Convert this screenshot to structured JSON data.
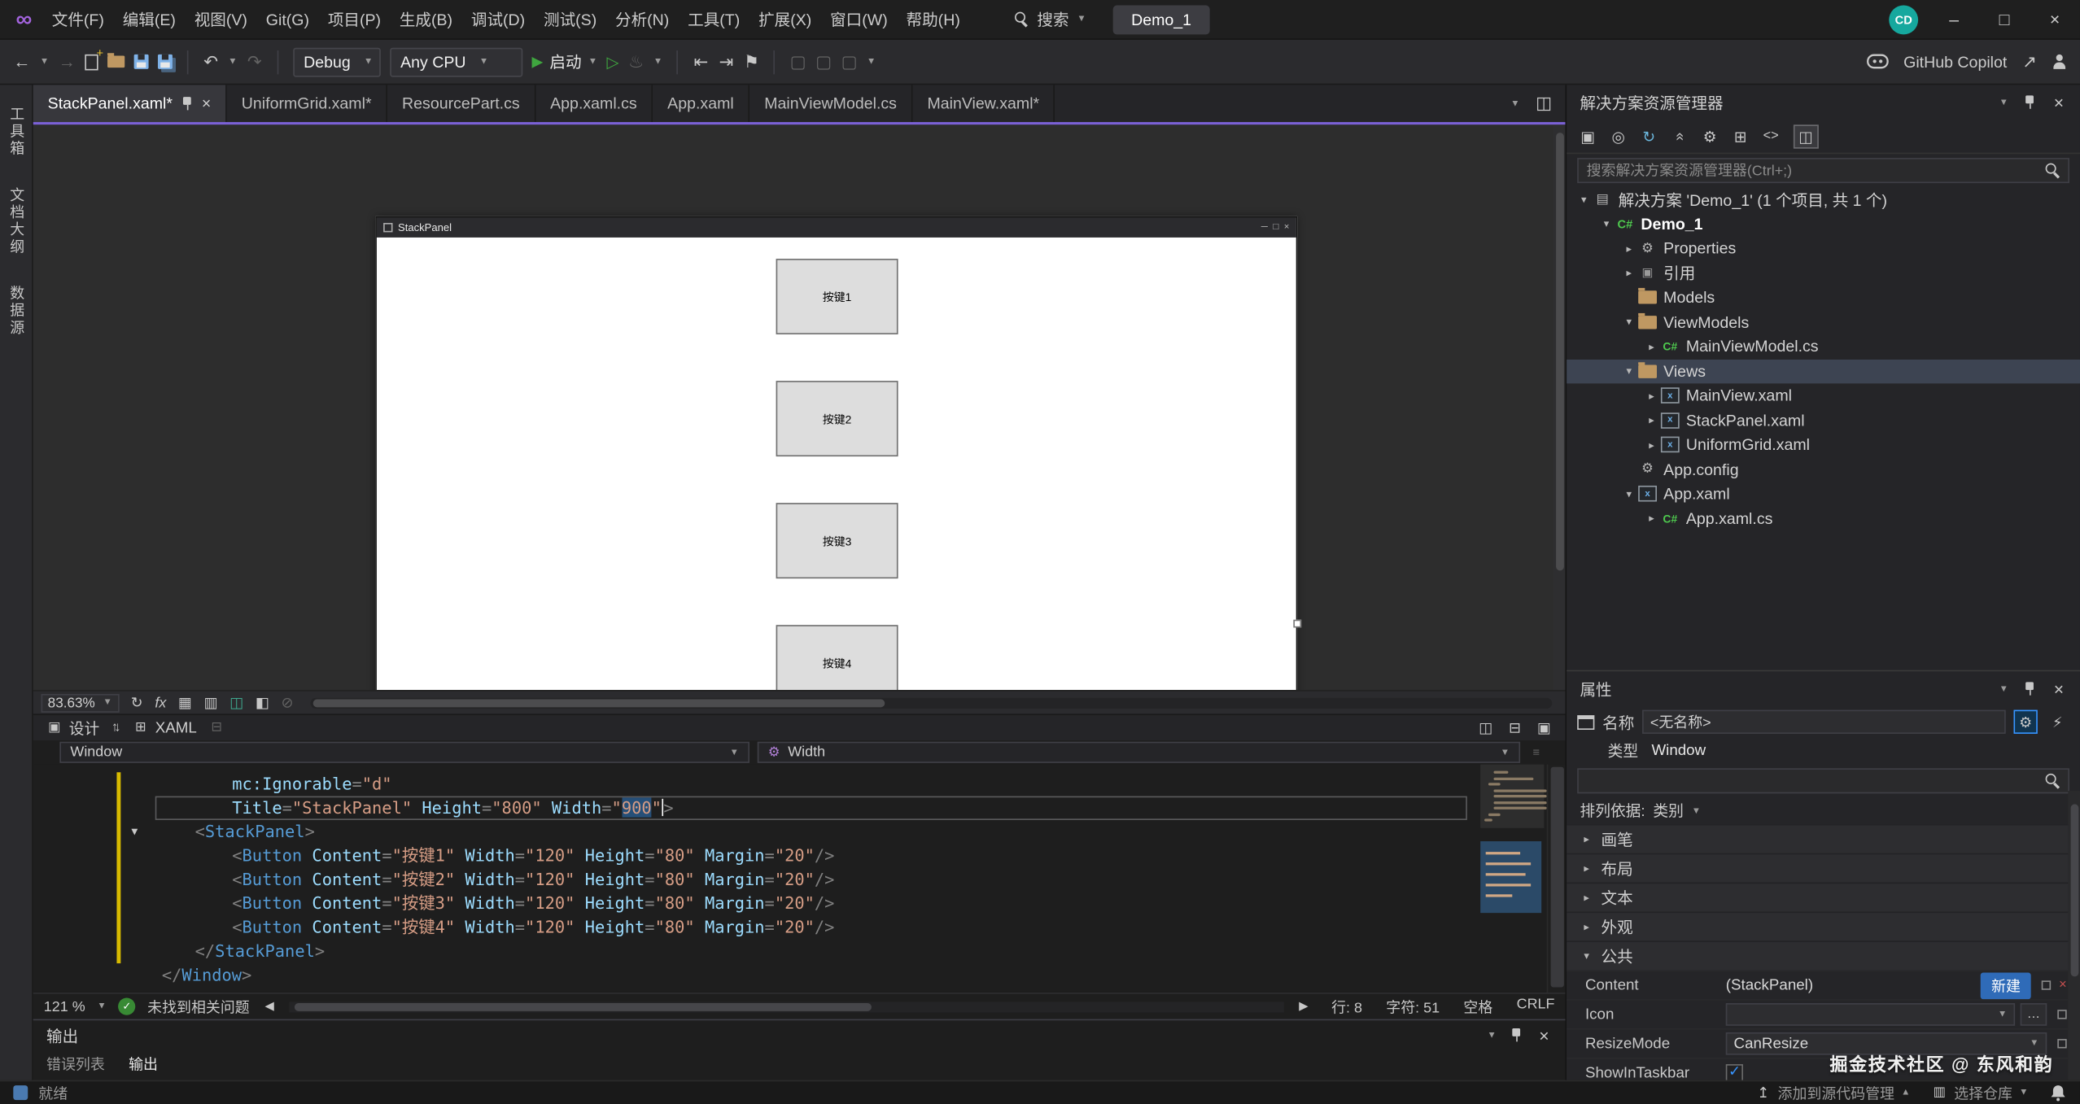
{
  "colors": {
    "accent_purple": "#7b61d6",
    "selection_blue": "#264f78",
    "run_green": "#3fa63f",
    "modified_yellow": "#d7ba00",
    "folder_gold": "#bf9862",
    "csharp_green": "#4ec94e",
    "avatar_teal": "#16a89e",
    "check_blue": "#3794ff",
    "new_button_blue": "#2f6bb8",
    "close_red": "#c75050",
    "logo_purple": "#a263dc",
    "status_ok_green": "#388a34"
  },
  "titlebar": {
    "menus": [
      "文件(F)",
      "编辑(E)",
      "视图(V)",
      "Git(G)",
      "项目(P)",
      "生成(B)",
      "调试(D)",
      "测试(S)",
      "分析(N)",
      "工具(T)",
      "扩展(X)",
      "窗口(W)",
      "帮助(H)"
    ],
    "search_label": "搜索",
    "solution_name": "Demo_1",
    "account_initials": "CD"
  },
  "toolbar": {
    "debug_target": "Debug",
    "platform": "Any CPU",
    "start_label": "启动",
    "copilot_label": "GitHub Copilot"
  },
  "left_strip": [
    "工具箱",
    "文档大纲",
    "数据源"
  ],
  "doc_tabs": {
    "active_index": 0,
    "items": [
      "StackPanel.xaml*",
      "UniformGrid.xaml*",
      "ResourcePart.cs",
      "App.xaml.cs",
      "App.xaml",
      "MainViewModel.cs",
      "MainView.xaml*"
    ]
  },
  "designer": {
    "window_title": "StackPanel",
    "buttons": [
      "按键1",
      "按键2",
      "按键3",
      "按键4"
    ],
    "zoom": "83.63%"
  },
  "split_tabs": {
    "design": "设计",
    "xaml": "XAML"
  },
  "breadcrumb": {
    "element": "Window",
    "member": "Width"
  },
  "code": {
    "lines": [
      {
        "indent": 53,
        "tokens": [
          {
            "t": "mc:Ignorable",
            "c": "attr"
          },
          {
            "t": "=",
            "c": "delim"
          },
          {
            "t": "\"d\"",
            "c": "str"
          }
        ]
      },
      {
        "indent": 53,
        "current": true,
        "tokens": [
          {
            "t": "Title",
            "c": "attr"
          },
          {
            "t": "=",
            "c": "delim"
          },
          {
            "t": "\"StackPanel\"",
            "c": "str"
          },
          {
            "t": " ",
            "c": "sp"
          },
          {
            "t": "Height",
            "c": "attr"
          },
          {
            "t": "=",
            "c": "delim"
          },
          {
            "t": "\"800\"",
            "c": "str"
          },
          {
            "t": " ",
            "c": "sp"
          },
          {
            "t": "Width",
            "c": "attr"
          },
          {
            "t": "=",
            "c": "delim"
          },
          {
            "t": "\"",
            "c": "str"
          },
          {
            "t": "900",
            "c": "str",
            "sel": true
          },
          {
            "t": "\"",
            "c": "str",
            "caret": true
          },
          {
            "t": ">",
            "c": "delim"
          }
        ]
      },
      {
        "indent": 25,
        "fold": "open",
        "tokens": [
          {
            "t": "<",
            "c": "delim"
          },
          {
            "t": "StackPanel",
            "c": "tag"
          },
          {
            "t": ">",
            "c": "delim"
          }
        ]
      },
      {
        "indent": 53,
        "tokens": [
          {
            "t": "<",
            "c": "delim"
          },
          {
            "t": "Button",
            "c": "tag"
          },
          {
            "t": " ",
            "c": "sp"
          },
          {
            "t": "Content",
            "c": "attr"
          },
          {
            "t": "=",
            "c": "delim"
          },
          {
            "t": "\"按键1\"",
            "c": "str"
          },
          {
            "t": " ",
            "c": "sp"
          },
          {
            "t": "Width",
            "c": "attr"
          },
          {
            "t": "=",
            "c": "delim"
          },
          {
            "t": "\"120\"",
            "c": "str"
          },
          {
            "t": " ",
            "c": "sp"
          },
          {
            "t": "Height",
            "c": "attr"
          },
          {
            "t": "=",
            "c": "delim"
          },
          {
            "t": "\"80\"",
            "c": "str"
          },
          {
            "t": " ",
            "c": "sp"
          },
          {
            "t": "Margin",
            "c": "attr"
          },
          {
            "t": "=",
            "c": "delim"
          },
          {
            "t": "\"20\"",
            "c": "str"
          },
          {
            "t": "/>",
            "c": "delim"
          }
        ]
      },
      {
        "indent": 53,
        "tokens": [
          {
            "t": "<",
            "c": "delim"
          },
          {
            "t": "Button",
            "c": "tag"
          },
          {
            "t": " ",
            "c": "sp"
          },
          {
            "t": "Content",
            "c": "attr"
          },
          {
            "t": "=",
            "c": "delim"
          },
          {
            "t": "\"按键2\"",
            "c": "str"
          },
          {
            "t": " ",
            "c": "sp"
          },
          {
            "t": "Width",
            "c": "attr"
          },
          {
            "t": "=",
            "c": "delim"
          },
          {
            "t": "\"120\"",
            "c": "str"
          },
          {
            "t": " ",
            "c": "sp"
          },
          {
            "t": "Height",
            "c": "attr"
          },
          {
            "t": "=",
            "c": "delim"
          },
          {
            "t": "\"80\"",
            "c": "str"
          },
          {
            "t": " ",
            "c": "sp"
          },
          {
            "t": "Margin",
            "c": "attr"
          },
          {
            "t": "=",
            "c": "delim"
          },
          {
            "t": "\"20\"",
            "c": "str"
          },
          {
            "t": "/>",
            "c": "delim"
          }
        ]
      },
      {
        "indent": 53,
        "tokens": [
          {
            "t": "<",
            "c": "delim"
          },
          {
            "t": "Button",
            "c": "tag"
          },
          {
            "t": " ",
            "c": "sp"
          },
          {
            "t": "Content",
            "c": "attr"
          },
          {
            "t": "=",
            "c": "delim"
          },
          {
            "t": "\"按键3\"",
            "c": "str"
          },
          {
            "t": " ",
            "c": "sp"
          },
          {
            "t": "Width",
            "c": "attr"
          },
          {
            "t": "=",
            "c": "delim"
          },
          {
            "t": "\"120\"",
            "c": "str"
          },
          {
            "t": " ",
            "c": "sp"
          },
          {
            "t": "Height",
            "c": "attr"
          },
          {
            "t": "=",
            "c": "delim"
          },
          {
            "t": "\"80\"",
            "c": "str"
          },
          {
            "t": " ",
            "c": "sp"
          },
          {
            "t": "Margin",
            "c": "attr"
          },
          {
            "t": "=",
            "c": "delim"
          },
          {
            "t": "\"20\"",
            "c": "str"
          },
          {
            "t": "/>",
            "c": "delim"
          }
        ]
      },
      {
        "indent": 53,
        "tokens": [
          {
            "t": "<",
            "c": "delim"
          },
          {
            "t": "Button",
            "c": "tag"
          },
          {
            "t": " ",
            "c": "sp"
          },
          {
            "t": "Content",
            "c": "attr"
          },
          {
            "t": "=",
            "c": "delim"
          },
          {
            "t": "\"按键4\"",
            "c": "str"
          },
          {
            "t": " ",
            "c": "sp"
          },
          {
            "t": "Width",
            "c": "attr"
          },
          {
            "t": "=",
            "c": "delim"
          },
          {
            "t": "\"120\"",
            "c": "str"
          },
          {
            "t": " ",
            "c": "sp"
          },
          {
            "t": "Height",
            "c": "attr"
          },
          {
            "t": "=",
            "c": "delim"
          },
          {
            "t": "\"80\"",
            "c": "str"
          },
          {
            "t": " ",
            "c": "sp"
          },
          {
            "t": "Margin",
            "c": "attr"
          },
          {
            "t": "=",
            "c": "delim"
          },
          {
            "t": "\"20\"",
            "c": "str"
          },
          {
            "t": "/>",
            "c": "delim"
          }
        ]
      },
      {
        "indent": 25,
        "tokens": [
          {
            "t": "</",
            "c": "delim"
          },
          {
            "t": "StackPanel",
            "c": "tag"
          },
          {
            "t": ">",
            "c": "delim"
          }
        ]
      },
      {
        "indent": 0,
        "tokens": [
          {
            "t": "</",
            "c": "delim"
          },
          {
            "t": "Window",
            "c": "tag"
          },
          {
            "t": ">",
            "c": "delim"
          }
        ]
      }
    ]
  },
  "editor_status": {
    "zoom": "121 %",
    "message": "未找到相关问题",
    "line": "行: 8",
    "column": "字符: 51",
    "whitespace": "空格",
    "line_ending": "CRLF"
  },
  "output_panel": {
    "title": "输出",
    "tabs": [
      "错误列表",
      "输出"
    ]
  },
  "statusbar": {
    "ready": "就绪",
    "scm_label": "添加到源代码管理",
    "repo_label": "选择仓库"
  },
  "solution_explorer": {
    "title": "解决方案资源管理器",
    "search_placeholder": "搜索解决方案资源管理器(Ctrl+;)",
    "tree": [
      {
        "label": "解决方案 'Demo_1' (1 个项目, 共 1 个)",
        "icon": "solution",
        "depth": 0,
        "chev": "open"
      },
      {
        "label": "Demo_1",
        "icon": "project",
        "depth": 1,
        "chev": "open",
        "bold": true
      },
      {
        "label": "Properties",
        "icon": "properties",
        "depth": 2,
        "chev": "closed"
      },
      {
        "label": "引用",
        "icon": "references",
        "depth": 2,
        "chev": "closed"
      },
      {
        "label": "Models",
        "icon": "folder",
        "depth": 2,
        "chev": "none"
      },
      {
        "label": "ViewModels",
        "icon": "folder",
        "depth": 2,
        "chev": "open"
      },
      {
        "label": "MainViewModel.cs",
        "icon": "csharp",
        "depth": 3,
        "chev": "closed"
      },
      {
        "label": "Views",
        "icon": "folder",
        "depth": 2,
        "chev": "open",
        "selected": true
      },
      {
        "label": "MainView.xaml",
        "icon": "xaml",
        "depth": 3,
        "chev": "closed"
      },
      {
        "label": "StackPanel.xaml",
        "icon": "xaml",
        "depth": 3,
        "chev": "closed"
      },
      {
        "label": "UniformGrid.xaml",
        "icon": "xaml",
        "depth": 3,
        "chev": "closed"
      },
      {
        "label": "App.config",
        "icon": "config",
        "depth": 2,
        "chev": "none"
      },
      {
        "label": "App.xaml",
        "icon": "xaml",
        "depth": 2,
        "chev": "open"
      },
      {
        "label": "App.xaml.cs",
        "icon": "csharp",
        "depth": 3,
        "chev": "closed"
      }
    ]
  },
  "properties_panel": {
    "title": "属性",
    "name_label": "名称",
    "name_value": "<无名称>",
    "type_label": "类型",
    "type_value": "Window",
    "arrange_label": "排列依据:",
    "arrange_mode": "类别",
    "categories": [
      {
        "label": "画笔",
        "expanded": false
      },
      {
        "label": "布局",
        "expanded": false
      },
      {
        "label": "文本",
        "expanded": false
      },
      {
        "label": "外观",
        "expanded": false
      },
      {
        "label": "公共",
        "expanded": true
      }
    ],
    "common": {
      "content_label": "Content",
      "content_value": "(StackPanel)",
      "new_button_label": "新建",
      "icon_label": "Icon",
      "resizemode_label": "ResizeMode",
      "resizemode_value": "CanResize",
      "showintaskbar_label": "ShowInTaskbar",
      "showintaskbar_checked": true
    }
  },
  "watermark": "掘金技术社区 @ 东风和韵"
}
